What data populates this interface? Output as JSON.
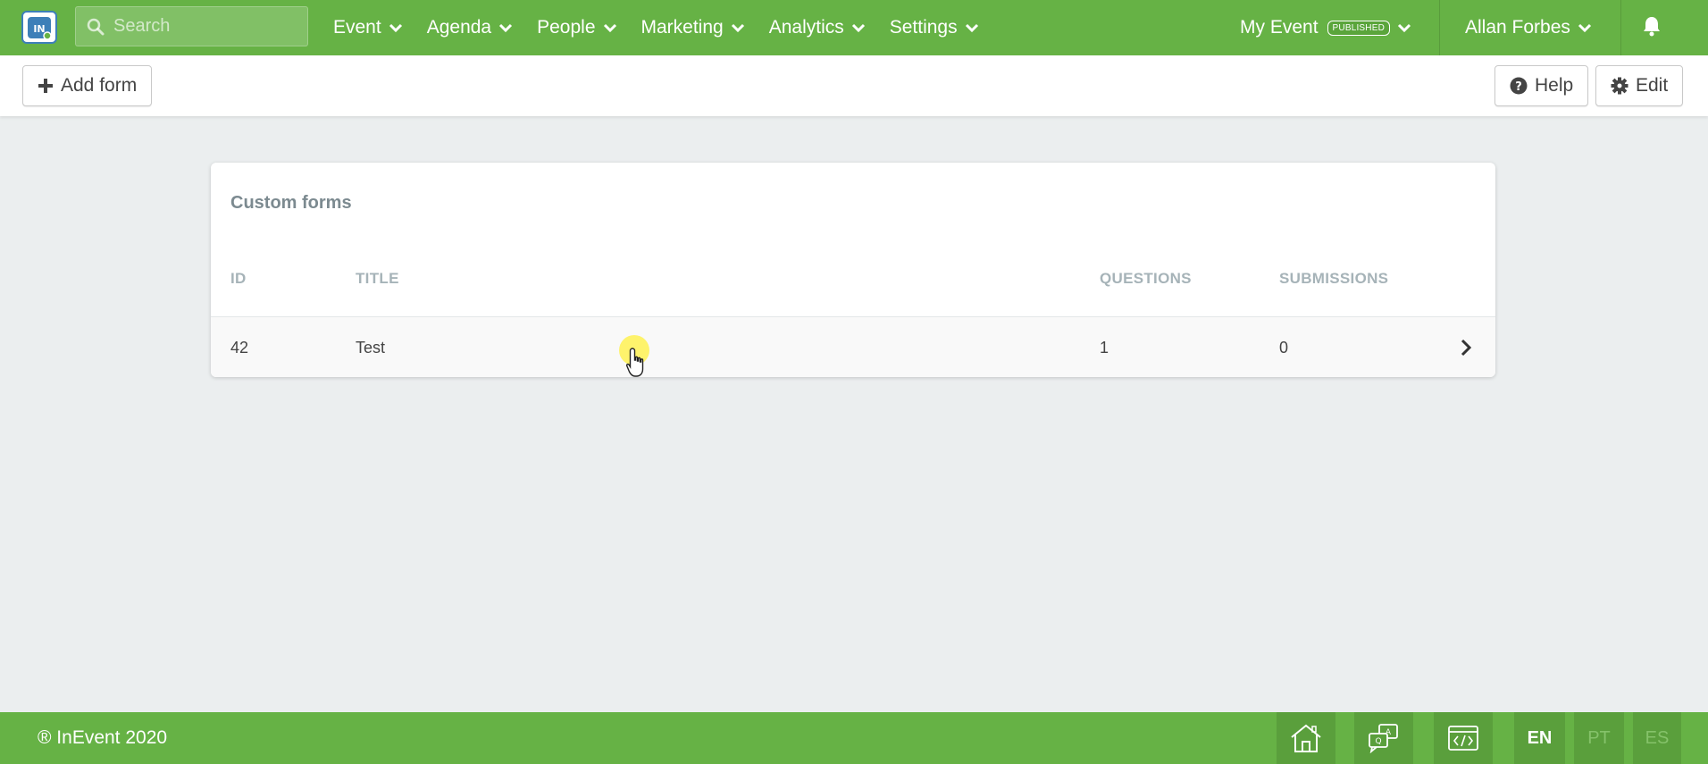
{
  "topbar": {
    "search_placeholder": "Search",
    "nav": [
      "Event",
      "Agenda",
      "People",
      "Marketing",
      "Analytics",
      "Settings"
    ],
    "event_name": "My Event",
    "event_status": "PUBLISHED",
    "user_name": "Allan Forbes"
  },
  "toolbar": {
    "add_label": "Add form",
    "help_label": "Help",
    "edit_label": "Edit"
  },
  "card": {
    "title": "Custom forms",
    "columns": [
      "ID",
      "TITLE",
      "QUESTIONS",
      "SUBMISSIONS"
    ],
    "rows": [
      {
        "id": "42",
        "title": "Test",
        "questions": "1",
        "submissions": "0"
      }
    ]
  },
  "footer": {
    "copyright": "® InEvent 2020",
    "languages": [
      "EN",
      "PT",
      "ES"
    ],
    "active_language": "EN"
  },
  "colors": {
    "brand_green": "#66b245",
    "background": "#ebeeef"
  }
}
